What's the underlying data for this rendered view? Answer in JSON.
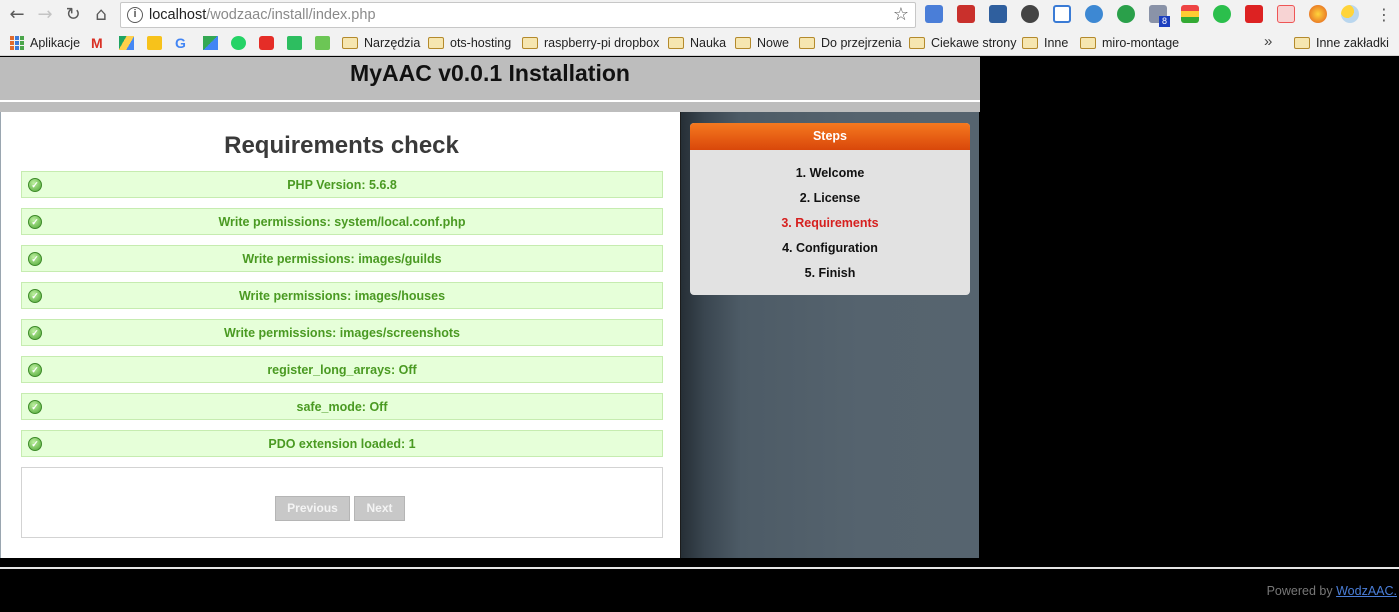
{
  "browser": {
    "url_host": "localhost",
    "url_path": "/wodzaac/install/index.php",
    "bookmarks": [
      {
        "label": "Aplikacje",
        "icon": "apps-icon"
      },
      {
        "label": "Narzędzia",
        "icon": "folder-icon"
      },
      {
        "label": "ots-hosting",
        "icon": "folder-icon"
      },
      {
        "label": "raspberry-pi dropbox",
        "icon": "folder-icon"
      },
      {
        "label": "Nauka",
        "icon": "folder-icon"
      },
      {
        "label": "Nowe",
        "icon": "folder-icon"
      },
      {
        "label": "Do przejrzenia",
        "icon": "folder-icon"
      },
      {
        "label": "Ciekawe strony",
        "icon": "folder-icon"
      },
      {
        "label": "Inne",
        "icon": "folder-icon"
      },
      {
        "label": "miro-montage",
        "icon": "folder-icon"
      }
    ],
    "overflow_chevron": "»",
    "other_bookmarks": "Inne zakładki",
    "extension_badge": "8"
  },
  "page": {
    "title": "MyAAC v0.0.1 Installation",
    "section_title": "Requirements check",
    "requirements": [
      "PHP Version: 5.6.8",
      "Write permissions: system/local.conf.php",
      "Write permissions: images/guilds",
      "Write permissions: images/houses",
      "Write permissions: images/screenshots",
      "register_long_arrays: Off",
      "safe_mode: Off",
      "PDO extension loaded: 1"
    ],
    "buttons": {
      "previous": "Previous",
      "next": "Next"
    },
    "steps": {
      "header": "Steps",
      "items": [
        "1. Welcome",
        "2. License",
        "3. Requirements",
        "4. Configuration",
        "5. Finish"
      ],
      "active_index": 2
    },
    "footer": {
      "prefix": "Powered by",
      "link": "WodzAAC."
    }
  },
  "colors": {
    "header_bg": "#bdbdbd",
    "steps_header": "#e8610f",
    "active_step": "#d6201f",
    "req_ok_text": "#4a9a22",
    "req_ok_bg": "#e6ffd9"
  }
}
